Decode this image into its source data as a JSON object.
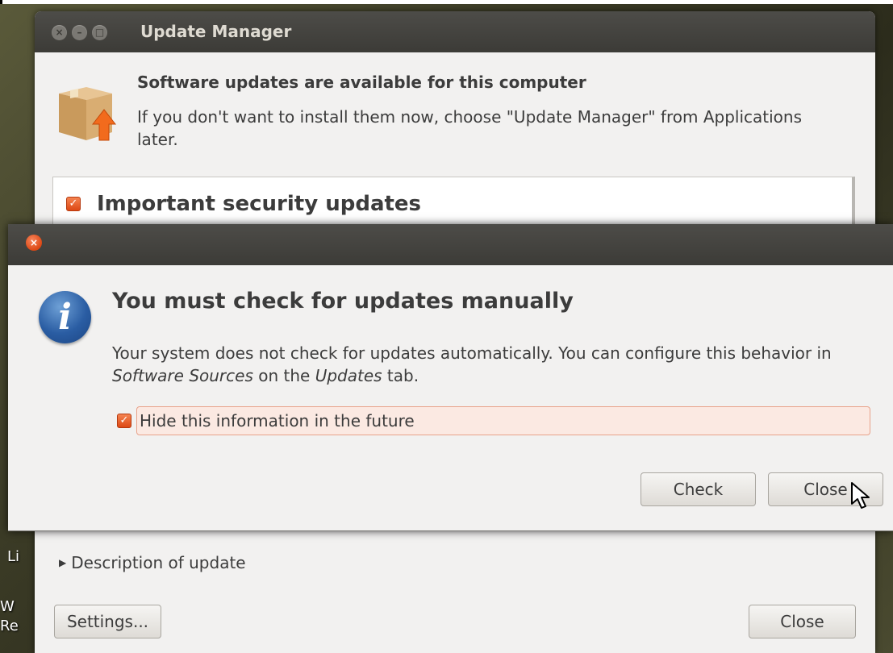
{
  "update_manager": {
    "title": "Update Manager",
    "heading": "Software updates are available for this computer",
    "subtext": "If you don't want to install them now, choose \"Update Manager\" from Applications later.",
    "list": {
      "group_label": "Important security updates",
      "group_checked": true
    },
    "expander_label": "Description of update",
    "settings_button": "Settings...",
    "close_button": "Close"
  },
  "dialog": {
    "heading": "You must check for updates manually",
    "body_part1": "Your system does not check for updates automatically. You can configure this behavior in ",
    "body_sources": "Software Sources",
    "body_part2": " on the ",
    "body_updates": "Updates",
    "body_part3": " tab.",
    "hide_label": "Hide this information in the future",
    "hide_checked": true,
    "check_button": "Check",
    "close_button": "Close"
  },
  "desktop": {
    "text_line1": "Li",
    "text_line2": "W",
    "text_line3": "Re"
  },
  "icons": {
    "window_close": "close-icon",
    "window_minimize": "minimize-icon",
    "window_maximize": "maximize-icon",
    "package": "package-update-icon",
    "info": "info-icon",
    "pointer": "mouse-pointer-icon"
  },
  "colors": {
    "accent": "#dd4814",
    "titlebar": "#3c3b37",
    "window_bg": "#f2f1f0",
    "highlight_bg": "#fbe9e2"
  }
}
